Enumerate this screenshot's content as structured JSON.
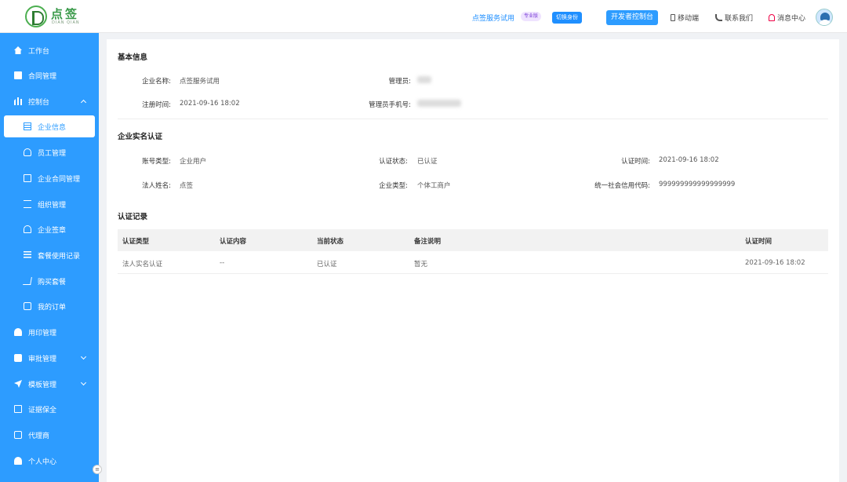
{
  "header": {
    "logo_text": "点签",
    "logo_sub": "DIAN QIAN",
    "org_name": "点签服务试用",
    "edition_badge": "专业版",
    "switch_identity": "切换身份",
    "developer_console": "开发者控制台",
    "mobile": "移动端",
    "contact": "联系我们",
    "messages": "消息中心"
  },
  "sidebar": {
    "items": [
      {
        "label": "工作台"
      },
      {
        "label": "合同管理"
      },
      {
        "label": "控制台"
      },
      {
        "label": "企业信息"
      },
      {
        "label": "员工管理"
      },
      {
        "label": "企业合同管理"
      },
      {
        "label": "组织管理"
      },
      {
        "label": "企业签章"
      },
      {
        "label": "套餐使用记录"
      },
      {
        "label": "购买套餐"
      },
      {
        "label": "我的订单"
      },
      {
        "label": "用印管理"
      },
      {
        "label": "审批管理"
      },
      {
        "label": "模板管理"
      },
      {
        "label": "证据保全"
      },
      {
        "label": "代理商"
      },
      {
        "label": "个人中心"
      }
    ]
  },
  "basic_info": {
    "title": "基本信息",
    "company_label": "企业名称:",
    "company_value": "点签服务试用",
    "admin_label": "管理员:",
    "reg_label": "注册时间:",
    "reg_value": "2021-09-16 18:02",
    "admin_phone_label": "管理员手机号:"
  },
  "verification": {
    "title": "企业实名认证",
    "account_type_label": "账号类型:",
    "account_type_value": "企业用户",
    "status_label": "认证状态:",
    "status_value": "已认证",
    "time_label": "认证时间:",
    "time_value": "2021-09-16 18:02",
    "legal_label": "法人姓名:",
    "legal_value": "点签",
    "company_type_label": "企业类型:",
    "company_type_value": "个体工商户",
    "credit_label": "统一社会信用代码:",
    "credit_value": "999999999999999999"
  },
  "records": {
    "title": "认证记录",
    "columns": [
      "认证类型",
      "认证内容",
      "当前状态",
      "备注说明",
      "认证时间"
    ],
    "rows": [
      [
        "法人实名认证",
        "--",
        "已认证",
        "暂无",
        "2021-09-16 18:02"
      ]
    ]
  },
  "colors": {
    "primary": "#2d9cff",
    "brand_green": "#3a9a4a"
  }
}
